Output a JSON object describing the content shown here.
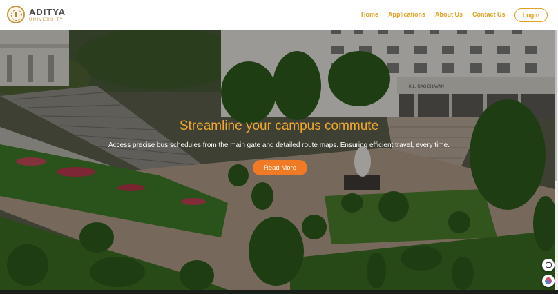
{
  "brand": {
    "name": "ADITYA",
    "subtitle": "UNIVERSITY"
  },
  "nav": {
    "items": [
      "Home",
      "Applications",
      "About Us",
      "Contact Us"
    ],
    "login_label": "Login"
  },
  "hero": {
    "title": "Streamline your campus commute",
    "subtitle": "Access precise bus schedules from the main gate and detailed route maps. Ensuring efficient travel, every time.",
    "button_label": "Read More",
    "building_sign": "K.L. RAO BHAVAN"
  },
  "colors": {
    "accent": "#e0a020",
    "title": "#f0a830",
    "button": "#f07b24"
  },
  "icons": {
    "floating_top": "chat-icon",
    "floating_bottom": "assistant-icon"
  }
}
